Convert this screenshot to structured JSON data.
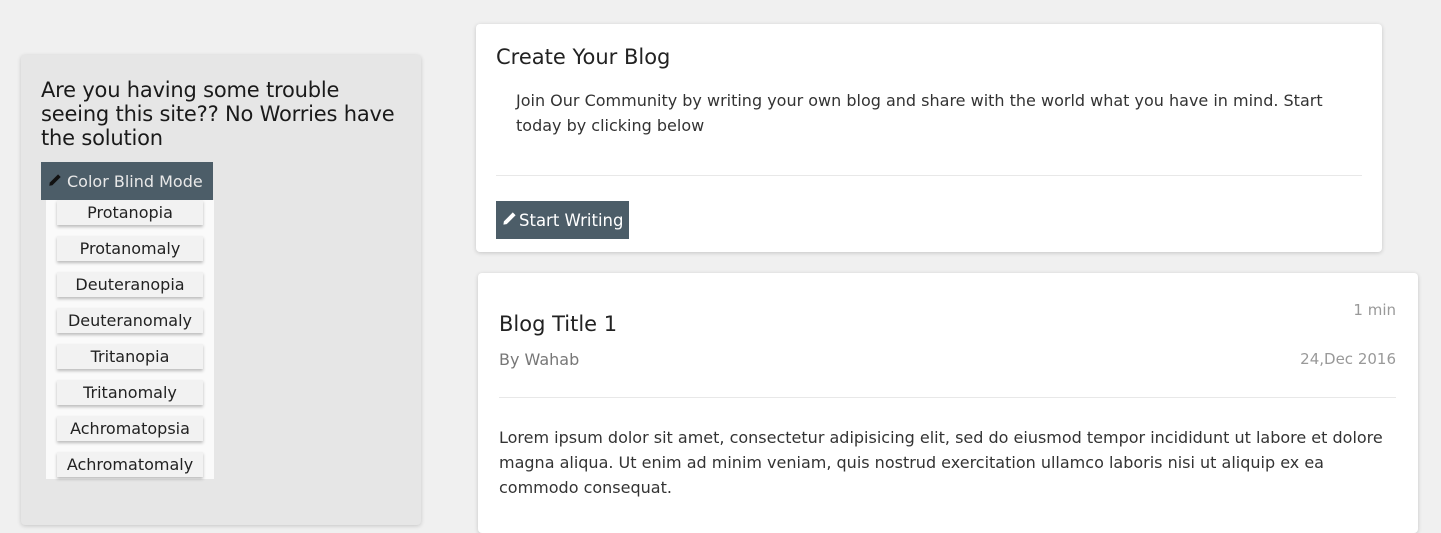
{
  "sidebar": {
    "heading": "Are you having some trouble seeing this site?? No Worries have the solution",
    "color_blind_button": "Color Blind Mode",
    "modes": [
      "Protanopia",
      "Protanomaly",
      "Deuteranopia",
      "Deuteranomaly",
      "Tritanopia",
      "Tritanomaly",
      "Achromatopsia",
      "Achromatomaly"
    ]
  },
  "create_blog": {
    "title": "Create Your Blog",
    "description": "Join Our Community by writing your own blog and share with the world what you have in mind. Start today by clicking below",
    "button_label": "Start Writing"
  },
  "blog_post": {
    "title": "Blog Title 1",
    "read_time": "1 min",
    "author": "By Wahab",
    "date": "24,Dec 2016",
    "body": "Lorem ipsum dolor sit amet, consectetur adipisicing elit, sed do eiusmod tempor incididunt ut labore et dolore magna aliqua. Ut enim ad minim veniam, quis nostrud exercitation ullamco laboris nisi ut aliquip ex ea commodo consequat."
  },
  "icons": {
    "pencil": "pencil-icon"
  },
  "colors": {
    "button_bg": "#4c5d68",
    "page_bg": "#f0f0f0",
    "sidebar_bg": "#e6e6e6"
  }
}
